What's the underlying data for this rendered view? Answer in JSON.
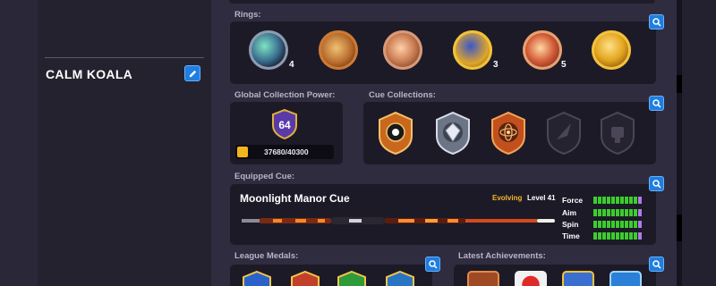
{
  "player": {
    "name": "CALM KOALA"
  },
  "sections": {
    "rings": {
      "label": "Rings:",
      "items": [
        {
          "name": "ring-1",
          "count": "4"
        },
        {
          "name": "ring-2",
          "count": ""
        },
        {
          "name": "ring-3",
          "count": ""
        },
        {
          "name": "ring-4",
          "count": "3"
        },
        {
          "name": "ring-5",
          "count": "5"
        },
        {
          "name": "ring-6",
          "count": ""
        }
      ]
    },
    "power": {
      "label": "Global Collection Power:",
      "level": "64",
      "progress_text": "37680/40300",
      "progress_fraction": 0.935
    },
    "cue_collections": {
      "label": "Cue Collections:"
    },
    "equipped_cue": {
      "label": "Equipped Cue:",
      "name": "Moonlight Manor Cue",
      "status": "Evolving",
      "level": "Level 41",
      "stats": [
        {
          "label": "Force",
          "value": 10,
          "max": 11
        },
        {
          "label": "Aim",
          "value": 10,
          "max": 11
        },
        {
          "label": "Spin",
          "value": 10,
          "max": 11
        },
        {
          "label": "Time",
          "value": 10,
          "max": 11
        }
      ]
    },
    "league_medals": {
      "label": "League Medals:"
    },
    "latest_achievements": {
      "label": "Latest Achievements:"
    }
  },
  "colors": {
    "accent": "#1f7ee0",
    "gold": "#f6b82a",
    "stat_green": "#3ccd2d",
    "stat_purple": "#b07be8"
  }
}
